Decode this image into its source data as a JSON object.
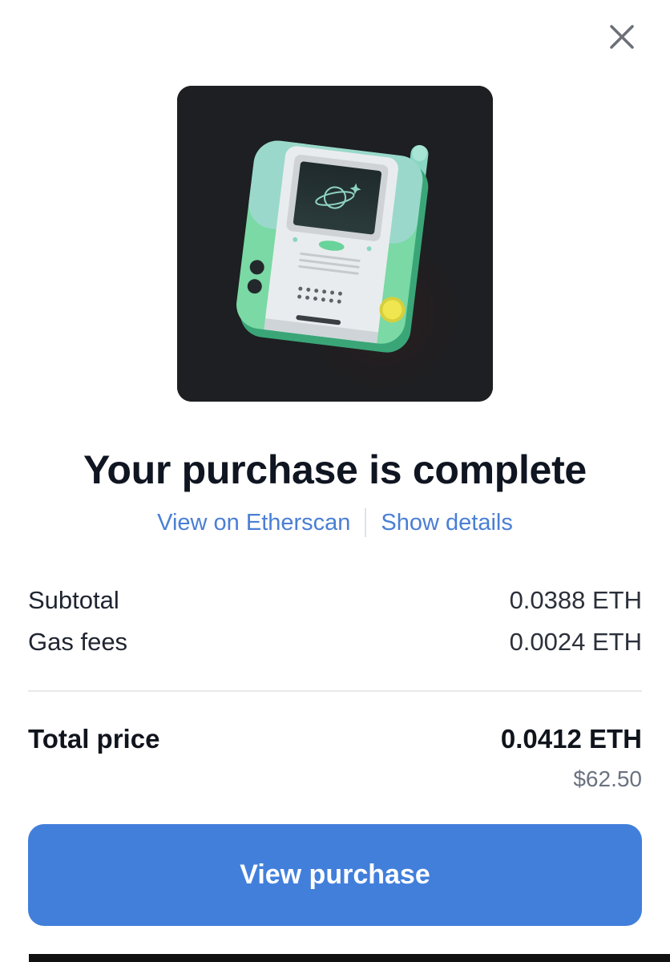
{
  "modal": {
    "title": "Your purchase is complete",
    "close_icon": "close-icon",
    "nft_image": "nft-retro-handheld-device-image"
  },
  "links": {
    "etherscan": "View on Etherscan",
    "details": "Show details"
  },
  "summary": {
    "subtotal_label": "Subtotal",
    "subtotal_value": "0.0388 ETH",
    "gas_label": "Gas fees",
    "gas_value": "0.0024 ETH",
    "total_label": "Total price",
    "total_value": "0.0412 ETH",
    "total_usd": "$62.50"
  },
  "actions": {
    "view_purchase": "View purchase"
  },
  "colors": {
    "accent": "#427fdb",
    "link": "#4a7fd4",
    "nft_background": "#1d1f22"
  }
}
